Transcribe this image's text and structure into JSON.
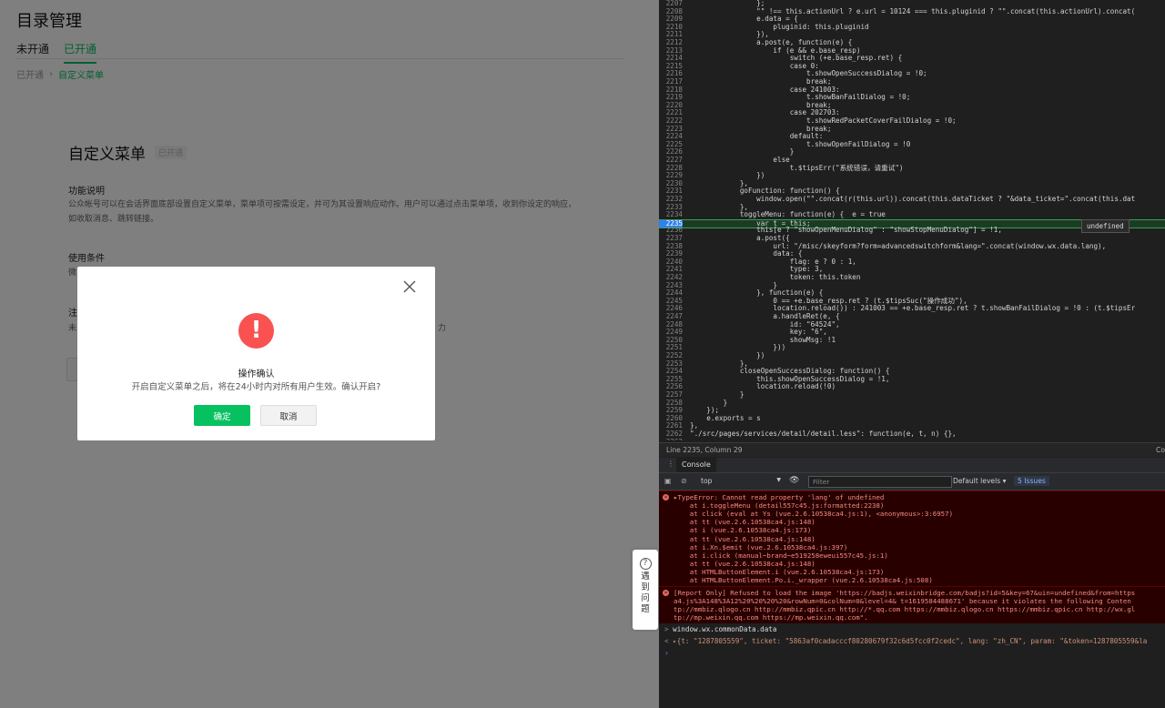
{
  "page": {
    "title": "目录管理",
    "tabs": [
      {
        "label": "未开通"
      },
      {
        "label": "已开通"
      }
    ],
    "breadcrumb": [
      {
        "label": "已开通"
      },
      {
        "label": "自定义菜单"
      }
    ],
    "card": {
      "title": "自定义菜单",
      "badge": "已开通",
      "feature_heading": "功能说明",
      "feature_text": "公众帐号可以在会话界面底部设置自定义菜单，菜单项可按需设定，并可为其设置响应动作。用户可以通过点击菜单项，收到你设定的响应，如收取消息、跳转链接。",
      "conditions_heading": "使用条件",
      "conditions_text": "微",
      "note_heading": "注",
      "note_text": "未",
      "note_tail": "力"
    },
    "dialog": {
      "title": "操作确认",
      "message": "开启自定义菜单之后，将在24小时内对所有用户生效。确认开启?",
      "confirm_label": "确定",
      "cancel_label": "取消"
    },
    "help": {
      "label": "遇到问题"
    }
  },
  "devtools": {
    "code_lines": [
      {
        "n": "2207",
        "t": "                };"
      },
      {
        "n": "2208",
        "t": "                \"\" !== this.actionUrl ? e.url = 10124 === this.pluginid ? \"\".concat(this.actionUrl).concat("
      },
      {
        "n": "2209",
        "t": "                e.data = {"
      },
      {
        "n": "2210",
        "t": "                    pluginid: this.pluginid"
      },
      {
        "n": "2211",
        "t": "                }),"
      },
      {
        "n": "2212",
        "t": "                a.post(e, function(e) {"
      },
      {
        "n": "2213",
        "t": "                    if (e && e.base_resp)"
      },
      {
        "n": "2214",
        "t": "                        switch (+e.base_resp.ret) {"
      },
      {
        "n": "2215",
        "t": "                        case 0:"
      },
      {
        "n": "2216",
        "t": "                            t.showOpenSuccessDialog = !0;"
      },
      {
        "n": "2217",
        "t": "                            break;"
      },
      {
        "n": "2218",
        "t": "                        case 241003:"
      },
      {
        "n": "2219",
        "t": "                            t.showBanFailDialog = !0;"
      },
      {
        "n": "2220",
        "t": "                            break;"
      },
      {
        "n": "2221",
        "t": "                        case 202703:"
      },
      {
        "n": "2222",
        "t": "                            t.showRedPacketCoverFailDialog = !0;"
      },
      {
        "n": "2223",
        "t": "                            break;"
      },
      {
        "n": "2224",
        "t": "                        default:"
      },
      {
        "n": "2225",
        "t": "                            t.showOpenFailDialog = !0"
      },
      {
        "n": "2226",
        "t": "                        }"
      },
      {
        "n": "2227",
        "t": "                    else"
      },
      {
        "n": "2228",
        "t": "                        t.$tipsErr(\"系统错误，请重试\")"
      },
      {
        "n": "2229",
        "t": "                })"
      },
      {
        "n": "2230",
        "t": "            },"
      },
      {
        "n": "2231",
        "t": "            goFunction: function() {"
      },
      {
        "n": "2232",
        "t": "                window.open(\"\".concat(r(this.url)).concat(this.dataTicket ? \"&data_ticket=\".concat(this.dat"
      },
      {
        "n": "2233",
        "t": "            },"
      },
      {
        "n": "2234",
        "t": "            toggleMenu: function(e) {  e = true"
      },
      {
        "n": "2235",
        "t": "                var t = this;",
        "hl": true
      },
      {
        "n": "2236",
        "t": "                this[e ? \"showOpenMenuDialog\" : \"showStopMenuDialog\"] = !1,"
      },
      {
        "n": "2237",
        "t": "                a.post({"
      },
      {
        "n": "2238",
        "t": "                    url: \"/misc/skeyform?form=advancedswitchform&lang=\".concat(window.wx.data.lang),"
      },
      {
        "n": "2239",
        "t": "                    data: {"
      },
      {
        "n": "2240",
        "t": "                        flag: e ? 0 : 1,"
      },
      {
        "n": "2241",
        "t": "                        type: 3,"
      },
      {
        "n": "2242",
        "t": "                        token: this.token"
      },
      {
        "n": "2243",
        "t": "                    }"
      },
      {
        "n": "2244",
        "t": "                }, function(e) {"
      },
      {
        "n": "2245",
        "t": "                    0 == +e.base_resp.ret ? (t.$tipsSuc(\"操作成功\"),"
      },
      {
        "n": "2246",
        "t": "                    location.reload()) : 241003 == +e.base_resp.ret ? t.showBanFailDialog = !0 : (t.$tipsEr"
      },
      {
        "n": "2247",
        "t": "                    a.handleRet(e, {"
      },
      {
        "n": "2248",
        "t": "                        id: \"64524\","
      },
      {
        "n": "2249",
        "t": "                        key: \"6\","
      },
      {
        "n": "2250",
        "t": "                        showMsg: !1"
      },
      {
        "n": "2251",
        "t": "                    }))"
      },
      {
        "n": "2252",
        "t": "                })"
      },
      {
        "n": "2253",
        "t": "            },"
      },
      {
        "n": "2254",
        "t": "            closeOpenSuccessDialog: function() {"
      },
      {
        "n": "2255",
        "t": "                this.showOpenSuccessDialog = !1,"
      },
      {
        "n": "2256",
        "t": "                location.reload(!0)"
      },
      {
        "n": "2257",
        "t": "            }"
      },
      {
        "n": "2258",
        "t": "        }"
      },
      {
        "n": "2259",
        "t": "    });"
      },
      {
        "n": "2260",
        "t": "    e.exports = s"
      },
      {
        "n": "2261",
        "t": "},"
      },
      {
        "n": "2262",
        "t": "\"./src/pages/services/detail/detail.less\": function(e, t, n) {},"
      },
      {
        "n": "2263",
        "t": ""
      }
    ],
    "tooltip": "undefined",
    "status": {
      "position": "Line 2235, Column 29",
      "right": "Co"
    },
    "drawer_tab": "Console",
    "toolbar": {
      "context": "top",
      "filter_placeholder": "Filter",
      "levels": "Default levels ▾",
      "issues": "5 Issues"
    },
    "error1": [
      "TypeError: Cannot read property 'lang' of undefined",
      "    at i.toggleMenu (detail557c45.js:formatted:2238)",
      "    at click (eval at Ys (vue.2.6.10538ca4.js:1), <anonymous>:3:6957)",
      "    at tt (vue.2.6.10538ca4.js:148)",
      "    at i (vue.2.6.10538ca4.js:173)",
      "    at tt (vue.2.6.10538ca4.js:148)",
      "    at i.Xn.$emit (vue.2.6.10538ca4.js:397)",
      "    at i.click (manual~brand~e519258eweui557c45.js:1)",
      "    at tt (vue.2.6.10538ca4.js:148)",
      "    at HTMLButtonElement.i (vue.2.6.10538ca4.js:173)",
      "    at HTMLButtonElement.Po.i._wrapper (vue.2.6.10538ca4.js:508)"
    ],
    "error2": [
      "[Report Only] Refused to load the image 'https://badjs.weixinbridge.com/badjs?id=5&key=67&uin=undefined&from=https",
      "a4.js%3A148%3A12%20%20%20%20&rowNum=0&colNum=0&level=4& t=1619584488671' because it violates the following Conten",
      "tp://mmbiz.qlogo.cn http://mmbiz.qpic.cn http://*.qq.com https://mmbiz.qlogo.cn https://mmbiz.qpic.cn http://wx.gl",
      "tp://mp.weixin.qq.com https://mp.weixin.qq.com\"."
    ],
    "command": "window.wx.commonData.data",
    "result": "{t: \"1287805559\", ticket: \"5863af0cadacccf80280679f32c6d5fcc0f2cedc\", lang: \"zh_CN\", param: \"&token=1287805559&la"
  }
}
